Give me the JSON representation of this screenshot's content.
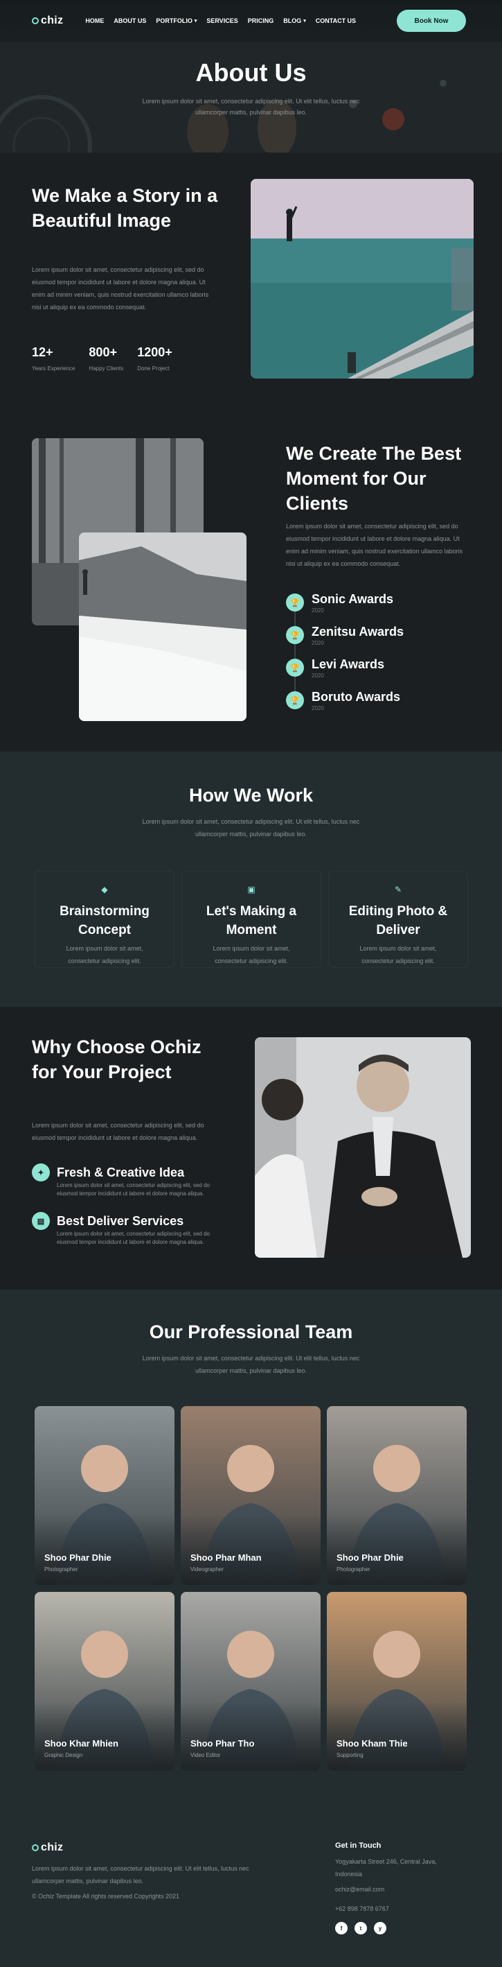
{
  "brand": {
    "name": "chiz",
    "accent": "#8fe5d4",
    "background": "#1b1f21",
    "panel": "#232d30"
  },
  "nav": {
    "items": [
      {
        "label": "HOME",
        "dropdown": false
      },
      {
        "label": "ABOUT US",
        "dropdown": false
      },
      {
        "label": "PORTFOLIO",
        "dropdown": true
      },
      {
        "label": "SERVICES",
        "dropdown": false
      },
      {
        "label": "PRICING",
        "dropdown": false
      },
      {
        "label": "BLOG",
        "dropdown": true
      },
      {
        "label": "CONTACT US",
        "dropdown": false
      }
    ],
    "cta": "Book Now"
  },
  "hero": {
    "title": "About Us",
    "sub1": "Lorem ipsum dolor sit amet, consectetur adipiscing elit. Ut elit tellus, luctus nec",
    "sub2": "ullamcorper mattis, pulvinar dapibus leo."
  },
  "story": {
    "title": "We Make a Story in a Beautiful Image",
    "body": "Lorem ipsum dolor sit amet, consectetur adipiscing elit, sed do eiusmod tempor incididunt ut labore et dolore magna aliqua. Ut enim ad minim veniam, quis nostrud exercitation ullamco laboris nisi ut aliquip ex ea commodo consequat.",
    "stats": [
      {
        "num": "12+",
        "label": "Years Experience"
      },
      {
        "num": "800+",
        "label": "Happy Clients"
      },
      {
        "num": "1200+",
        "label": "Done Project"
      }
    ]
  },
  "moment": {
    "title": "We Create The Best Moment for Our Clients",
    "body": "Lorem ipsum dolor sit amet, consectetur adipiscing elit, sed do eiusmod tempor incididunt ut labore et dolore magna aliqua. Ut enim ad minim veniam, quis nostrud exercitation ullamco laboris nisi ut aliquip ex ea commodo consequat.",
    "awards": [
      {
        "title": "Sonic Awards",
        "year": "2020"
      },
      {
        "title": "Zenitsu Awards",
        "year": "2020"
      },
      {
        "title": "Levi Awards",
        "year": "2020"
      },
      {
        "title": "Boruto Awards",
        "year": "2020"
      }
    ]
  },
  "how": {
    "title": "How We Work",
    "sub1": "Lorem ipsum dolor sit amet, consectetur adipiscing elit. Ut elit tellus, luctus nec",
    "sub2": "ullamcorper mattis, pulvinar dapibus leo.",
    "cards": [
      {
        "icon": "lightbulb-icon",
        "t1": "Brainstorming",
        "t2": "Concept",
        "p1": "Lorem ipsum dolor sit amet,",
        "p2": "consectetur adipiscing elit."
      },
      {
        "icon": "images-icon",
        "t1": "Let's Making a",
        "t2": "Moment",
        "p1": "Lorem ipsum dolor sit amet,",
        "p2": "consectetur adipiscing elit."
      },
      {
        "icon": "brush-icon",
        "t1": "Editing Photo &",
        "t2": "Deliver",
        "p1": "Lorem ipsum dolor sit amet,",
        "p2": "consectetur adipiscing elit."
      }
    ]
  },
  "why": {
    "title": "Why Choose Ochiz for Your Project",
    "body": "Lorem ipsum dolor sit amet, consectetur adipiscing elit, sed do eiusmod tempor incididunt ut labore et dolore magna aliqua.",
    "features": [
      {
        "title": "Fresh & Creative Idea",
        "body": "Lorem ipsum dolor sit amet, consectetur adipiscing elit, sed do eiusmod tempor incididunt ut labore et dolore magna aliqua."
      },
      {
        "title": "Best Deliver Services",
        "body": "Lorem ipsum dolor sit amet, consectetur adipiscing elit, sed do eiusmod tempor incididunt ut labore et dolore magna aliqua."
      }
    ]
  },
  "team": {
    "title": "Our Professional Team",
    "sub1": "Lorem ipsum dolor sit amet, consectetur adipiscing elit. Ut elit tellus, luctus nec",
    "sub2": "ullamcorper mattis, pulvinar dapibus leo.",
    "members": [
      {
        "name": "Shoo Phar Dhie",
        "role": "Photographer",
        "bg": "#8a9296"
      },
      {
        "name": "Shoo Phar Mhan",
        "role": "Videographer",
        "bg": "#9a7f6d"
      },
      {
        "name": "Shoo Phar Dhie",
        "role": "Photographer",
        "bg": "#a39d97"
      },
      {
        "name": "Shoo Khar Mhien",
        "role": "Graphic Design",
        "bg": "#b8b6ad"
      },
      {
        "name": "Shoo Phar Tho",
        "role": "Video Editor",
        "bg": "#a9a9a6"
      },
      {
        "name": "Shoo Kham Thie",
        "role": "Supporting",
        "bg": "#c99a6e"
      }
    ]
  },
  "footer": {
    "brand": "chiz",
    "desc": "Lorem ipsum dolor sit amet, consectetur adipiscing elit. Ut elit tellus, luctus nec ullamcorper mattis, pulvinar dapibus leo.",
    "copyright": "© Ochiz Template All rights reserved Copyrights 2021",
    "contact_title": "Get in Touch",
    "address": "Yogyakarta Street 246, Central Java, Indonesia",
    "email": "ochiz@email.com",
    "phone": "+62 898 7878 6767",
    "socials": [
      "f",
      "t",
      "y"
    ]
  }
}
